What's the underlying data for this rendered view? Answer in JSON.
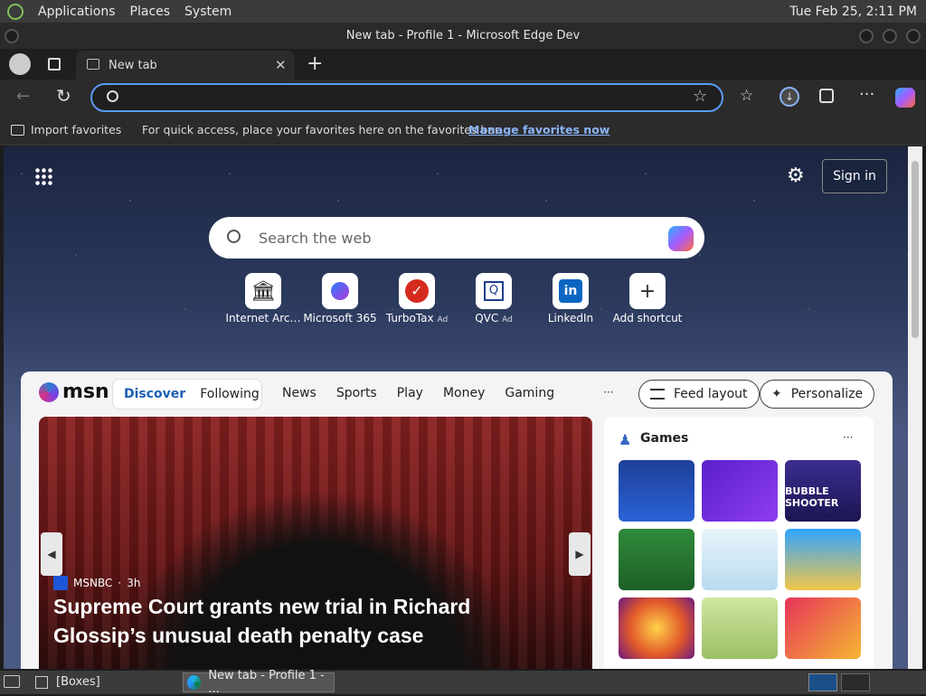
{
  "desktop": {
    "menu": [
      "Applications",
      "Places",
      "System"
    ],
    "clock": "Tue Feb 25,  2:11 PM"
  },
  "window": {
    "title": "New tab - Profile 1 - Microsoft Edge Dev"
  },
  "tabs": [
    {
      "label": "New tab"
    }
  ],
  "favorites_bar": {
    "import_label": "Import favorites",
    "hint": "For quick access, place your favorites here on the favorites bar.",
    "manage_link": "Manage favorites now"
  },
  "ntp": {
    "sign_in": "Sign in",
    "search_placeholder": "Search the web",
    "shortcuts": [
      {
        "label": "Internet Arc…",
        "ad": ""
      },
      {
        "label": "Microsoft 365",
        "ad": ""
      },
      {
        "label": "TurboTax",
        "ad": "Ad"
      },
      {
        "label": "QVC",
        "ad": "Ad"
      },
      {
        "label": "LinkedIn",
        "ad": ""
      },
      {
        "label": "Add shortcut",
        "ad": ""
      }
    ]
  },
  "feed": {
    "brand": "msn",
    "tabs": [
      "Discover",
      "Following"
    ],
    "nav": [
      "News",
      "Sports",
      "Play",
      "Money",
      "Gaming"
    ],
    "more": "···",
    "feed_layout": "Feed layout",
    "personalize": "Personalize",
    "hero": {
      "source": "MSNBC",
      "age": "3h",
      "headline": "Supreme Court grants new trial in Richard Glossip’s unusual death penalty case"
    },
    "games": {
      "title": "Games",
      "more": "···",
      "bubble_title": "BUBBLE SHOOTER"
    }
  },
  "taskbar": {
    "items": [
      "[Boxes]",
      "New tab - Profile 1 - ..."
    ]
  },
  "colors": {
    "accent": "#5a9bf3",
    "link": "#8ab4f8",
    "msn_blue": "#1a5fb4"
  }
}
